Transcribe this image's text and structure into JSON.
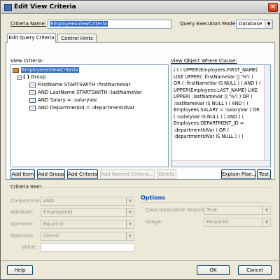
{
  "window": {
    "title": "Edit View Criteria",
    "close_glyph": "×"
  },
  "header": {
    "criteria_name_label": "Criteria Name:",
    "criteria_name_value": "EmployeesViewCriteria",
    "query_mode_label": "Query Execution Mode:",
    "query_mode_value": "Database"
  },
  "tabs": [
    {
      "label": "Edit Query Criteria",
      "active": true
    },
    {
      "label": "Control Hints",
      "active": false
    }
  ],
  "view_criteria": {
    "label": "View Criteria:",
    "tree": {
      "root": "EmployeesViewCriteria",
      "group": "Group",
      "conditions": [
        "FirstName STARTSWITH :firstNameVar",
        "AND LastName STARTSWITH :lastNameVar",
        "AND Salary = :salaryVar",
        "AND DepartmentId = :departmentIdVar"
      ]
    }
  },
  "where_clause": {
    "label": "View Object Where Clause:",
    "text": "( ( ( UPPER(Employees.FIRST_NAME) LIKE UPPER( :firstNameVar || '%') ) OR ( :firstNameVar IS NULL ) ) AND ( ( UPPER(Employees.LAST_NAME) LIKE UPPER( :lastNameVar || '%') ) OR ( :lastNameVar IS NULL ) ) AND ( ( Employees.SALARY = :salaryVar ) OR ( :salaryVar IS NULL ) ) AND ( ( Employees.DEPARTMENT_ID = :departmentIdVar ) OR ( :departmentIdVar IS NULL ) ) )"
  },
  "action_buttons": {
    "add_item": "Add Item",
    "add_group": "Add Group",
    "add_criteria": "Add Criteria",
    "add_named_criteria": "Add Named Criteria...",
    "delete": "Delete",
    "explain_plan": "Explain Plan...",
    "test": "Test"
  },
  "criteria_item": {
    "section_label": "Criteria Item",
    "conjunction_label": "Conjunction:",
    "conjunction_value": "AND",
    "attribute_label": "Attribute:",
    "attribute_value": "EmployeeId",
    "operator_label": "Operator:",
    "operator_value": "Equal to",
    "operand_label": "Operand:",
    "operand_value": "Literal",
    "value_label": "Value:",
    "value_value": ""
  },
  "options": {
    "title": "Options",
    "case_insensitive_label": "Case Insensitive Search:",
    "case_insensitive_value": "True",
    "usage_label": "Usage:",
    "usage_value": "Required"
  },
  "footer": {
    "help": "Help",
    "ok": "OK",
    "cancel": "Cancel"
  },
  "colors": {
    "selection": "#316ac5",
    "options_title": "#0046d5",
    "dialog_bg": "#ece9d8"
  }
}
